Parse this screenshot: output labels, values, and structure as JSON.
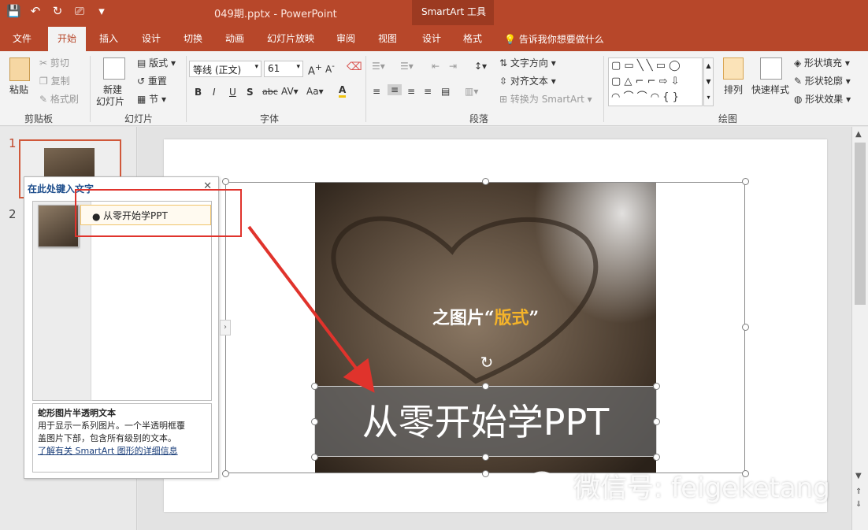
{
  "titlebar": {
    "doc_title": "049期.pptx - PowerPoint",
    "contextual_tools": "SmartArt 工具",
    "qat": {
      "save": "💾",
      "undo": "↶",
      "redo": "↻",
      "present": "⎚",
      "more": "▾"
    }
  },
  "tabs": {
    "file": "文件",
    "home": "开始",
    "insert": "插入",
    "design": "设计",
    "transitions": "切换",
    "animations": "动画",
    "slideshow": "幻灯片放映",
    "review": "审阅",
    "view": "视图",
    "sa_design": "设计",
    "sa_format": "格式",
    "tellme": "告诉我你想要做什么"
  },
  "ribbon": {
    "clipboard": {
      "paste": "粘贴",
      "cut": "剪切",
      "copy": "复制",
      "format_painter": "格式刷",
      "label": "剪贴板"
    },
    "slides": {
      "new_slide_1": "新建",
      "new_slide_2": "幻灯片",
      "layout": "版式",
      "reset": "重置",
      "section": "节",
      "label": "幻灯片"
    },
    "font": {
      "name": "等线 (正文)",
      "size": "61",
      "label": "字体"
    },
    "paragraph": {
      "text_direction": "文字方向",
      "align_text": "对齐文本",
      "convert_smartart": "转换为 SmartArt",
      "label": "段落"
    },
    "drawing": {
      "arrange": "排列",
      "quick_styles": "快速样式",
      "shape_fill": "形状填充",
      "shape_outline": "形状轮廓",
      "shape_effects": "形状效果",
      "label": "绘图"
    }
  },
  "thumbnails": {
    "slide1": "1",
    "slide2": "2"
  },
  "textpane": {
    "title": "在此处键入文字",
    "close": "✕",
    "item": "从零开始学PPT",
    "desc_title": "蛇形图片半透明文本",
    "desc_line1": "用于显示一系列图片。一个半透明框覆",
    "desc_line2": "盖图片下部，包含所有级别的文本。",
    "desc_link": "了解有关 SmartArt 图形的详细信息"
  },
  "slide": {
    "caption_pre": "之图片“",
    "caption_accent": "版式",
    "caption_post": "”",
    "band_text": "从零开始学PPT"
  },
  "watermark": "微信号: feigeketang",
  "colors": {
    "brand": "#b7472a",
    "accent": "#f4b32a",
    "annotation": "#e0332c"
  }
}
